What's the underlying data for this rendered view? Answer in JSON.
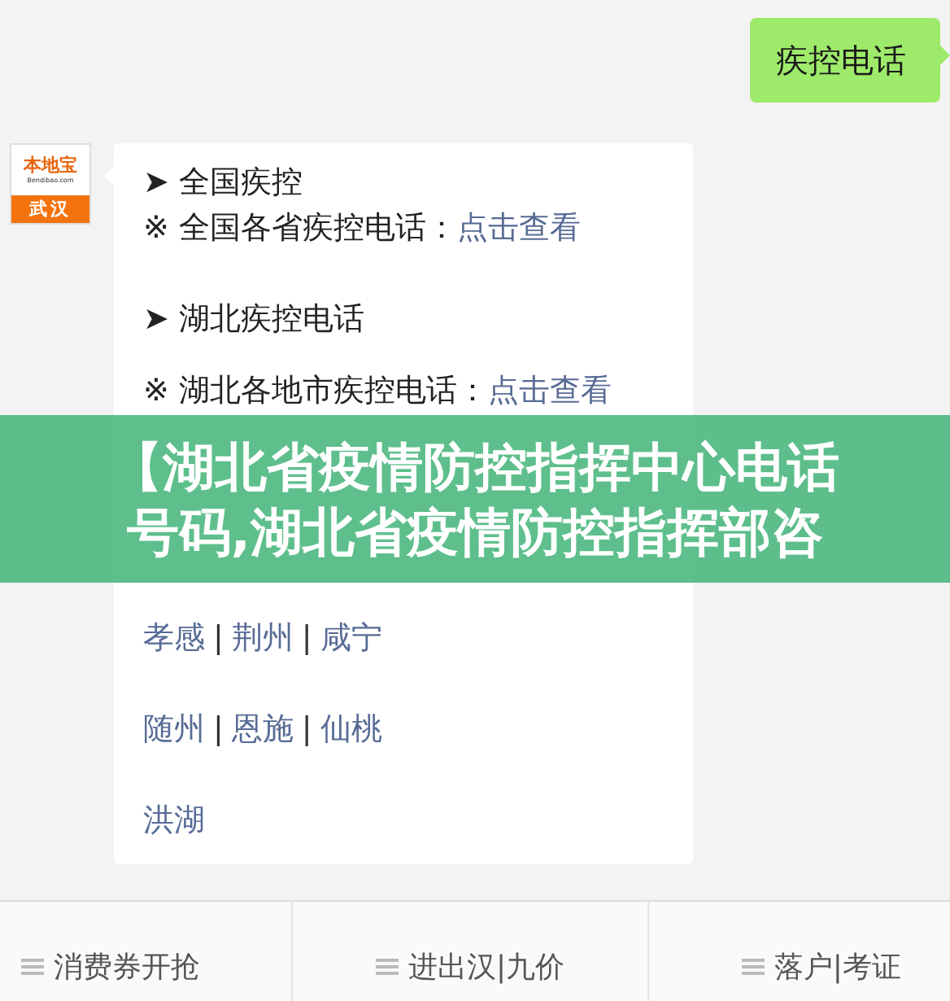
{
  "outgoing": {
    "text": "疾控电话"
  },
  "avatar": {
    "brand": "本地宝",
    "domain": "Bendibao.com",
    "city": "武汉"
  },
  "message": {
    "lines": [
      {
        "kind": "heading",
        "marker": "➤",
        "text": "全国疾控"
      },
      {
        "kind": "note",
        "marker": "※",
        "text": "全国各省疾控电话：",
        "link": "点击查看"
      },
      {
        "kind": "heading",
        "marker": "➤",
        "text": "湖北疾控电话"
      },
      {
        "kind": "note",
        "marker": "※",
        "text": "湖北各地市疾控电话：",
        "link": "点击查看"
      },
      {
        "kind": "cities",
        "separator": "|",
        "links": [
          "孝感",
          "荆州",
          "咸宁"
        ]
      },
      {
        "kind": "cities",
        "separator": "|",
        "links": [
          "随州",
          "恩施",
          "仙桃"
        ]
      },
      {
        "kind": "cities",
        "links": [
          "洪湖"
        ]
      }
    ]
  },
  "banner": {
    "lines": [
      "【湖北省疫情防控指挥中心电话",
      "号码,湖北省疫情防控指挥部咨"
    ]
  },
  "bottom_menu": [
    {
      "label": "消费券开抢"
    },
    {
      "label": "进出汉|九价"
    },
    {
      "label": "落户|考证"
    }
  ]
}
